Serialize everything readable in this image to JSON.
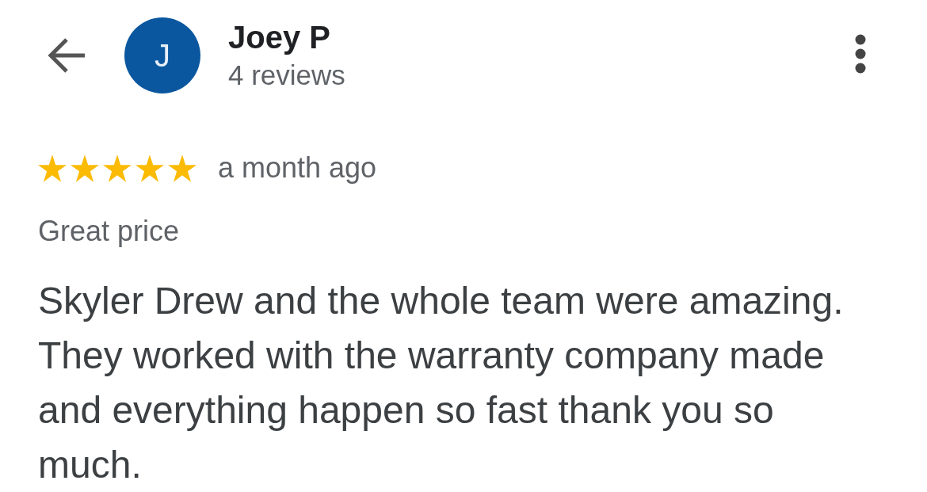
{
  "reviewer": {
    "initial": "J",
    "name": "Joey P",
    "reviews": "4 reviews"
  },
  "review": {
    "stars": 5,
    "time": "a month ago",
    "tag": "Great price",
    "text": "Skyler Drew and the whole team were amazing. They worked with the warranty company made and everything happen so fast thank you so much."
  }
}
